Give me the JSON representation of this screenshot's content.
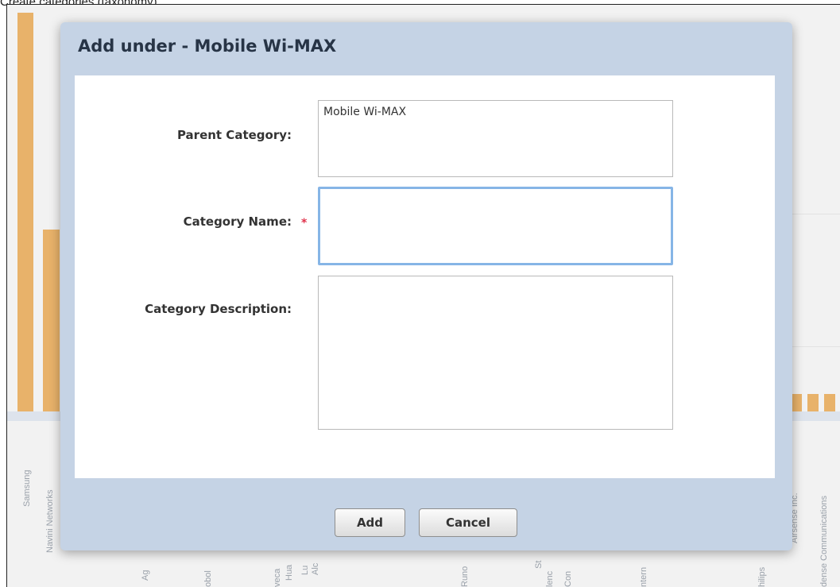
{
  "caption": "Create categories (taxonomy)",
  "background": {
    "bar_color": "#e8b26a",
    "labels": [
      "Samsung",
      "Navini Networks",
      "Ag",
      "obol",
      "veca",
      "Hua",
      "Lu",
      "Alc",
      "Runo",
      "St",
      "lenc",
      "Con",
      "ntern",
      "hilips",
      "Airsense Inc.",
      "dense Communications"
    ]
  },
  "dialog": {
    "title": "Add under - Mobile Wi-MAX",
    "fields": {
      "parent_label": "Parent Category:",
      "parent_value": "Mobile Wi-MAX",
      "name_label": "Category Name:",
      "name_required_marker": "*",
      "name_value": "",
      "description_label": "Category Description:",
      "description_value": ""
    },
    "buttons": {
      "add": "Add",
      "cancel": "Cancel"
    }
  },
  "colors": {
    "dialog_frame": "#c5d3e5",
    "focus_ring": "#86b5e6",
    "required": "#e0324b"
  }
}
